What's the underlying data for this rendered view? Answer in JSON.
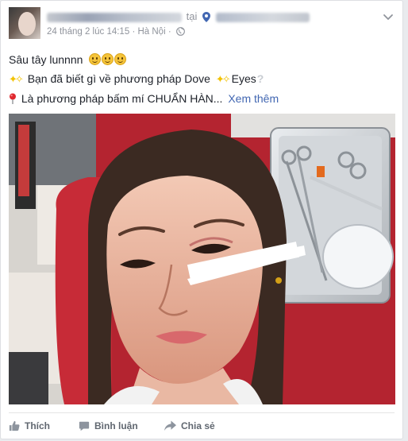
{
  "post": {
    "name_connector": "tại",
    "timestamp": "24 tháng 2 lúc 14:15",
    "separator": "·",
    "location": "Hà Nội",
    "text_line1": "Sâu tây lunnnn",
    "text_line2_mid": "Bạn đã biết gì về phương pháp Dove",
    "text_line2_end": "Eyes",
    "text_line3": "Là phương pháp bấm mí CHUẨN HÀN...",
    "see_more": "Xem thêm",
    "icons": {
      "privacy": "globe-icon",
      "menu": "chevron-down-icon",
      "place": "location-pin-icon",
      "bullet": "pushpin-icon"
    }
  },
  "actions": {
    "like": "Thích",
    "comment": "Bình luận",
    "share": "Chia sẻ"
  },
  "colors": {
    "link": "#4267b2",
    "meta": "#90949c",
    "action": "#606770",
    "photo_background": "#b42430"
  }
}
